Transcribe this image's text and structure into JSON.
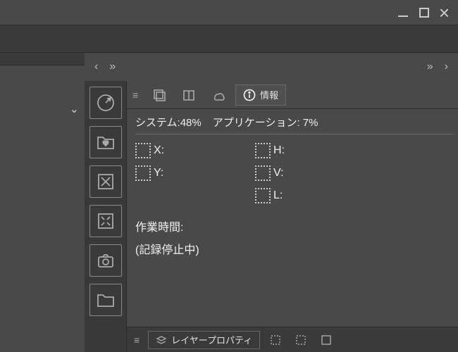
{
  "window": {
    "minimize": "_",
    "maximize": "☐",
    "close": "×"
  },
  "nav": {
    "back": "‹",
    "fwd_more": "»",
    "fwd": "›"
  },
  "tabs": {
    "active_label": "情報"
  },
  "info": {
    "system_label": "システム:",
    "system_value": "48%",
    "app_label": "アプリケーション:",
    "app_value": "7%",
    "coords": {
      "x": "X:",
      "y": "Y:",
      "h": "H:",
      "v": "V:",
      "l": "L:"
    },
    "work_time_label": "作業時間:",
    "status": "(記録停止中)"
  },
  "bottom": {
    "layer_props": "レイヤープロパティ"
  }
}
